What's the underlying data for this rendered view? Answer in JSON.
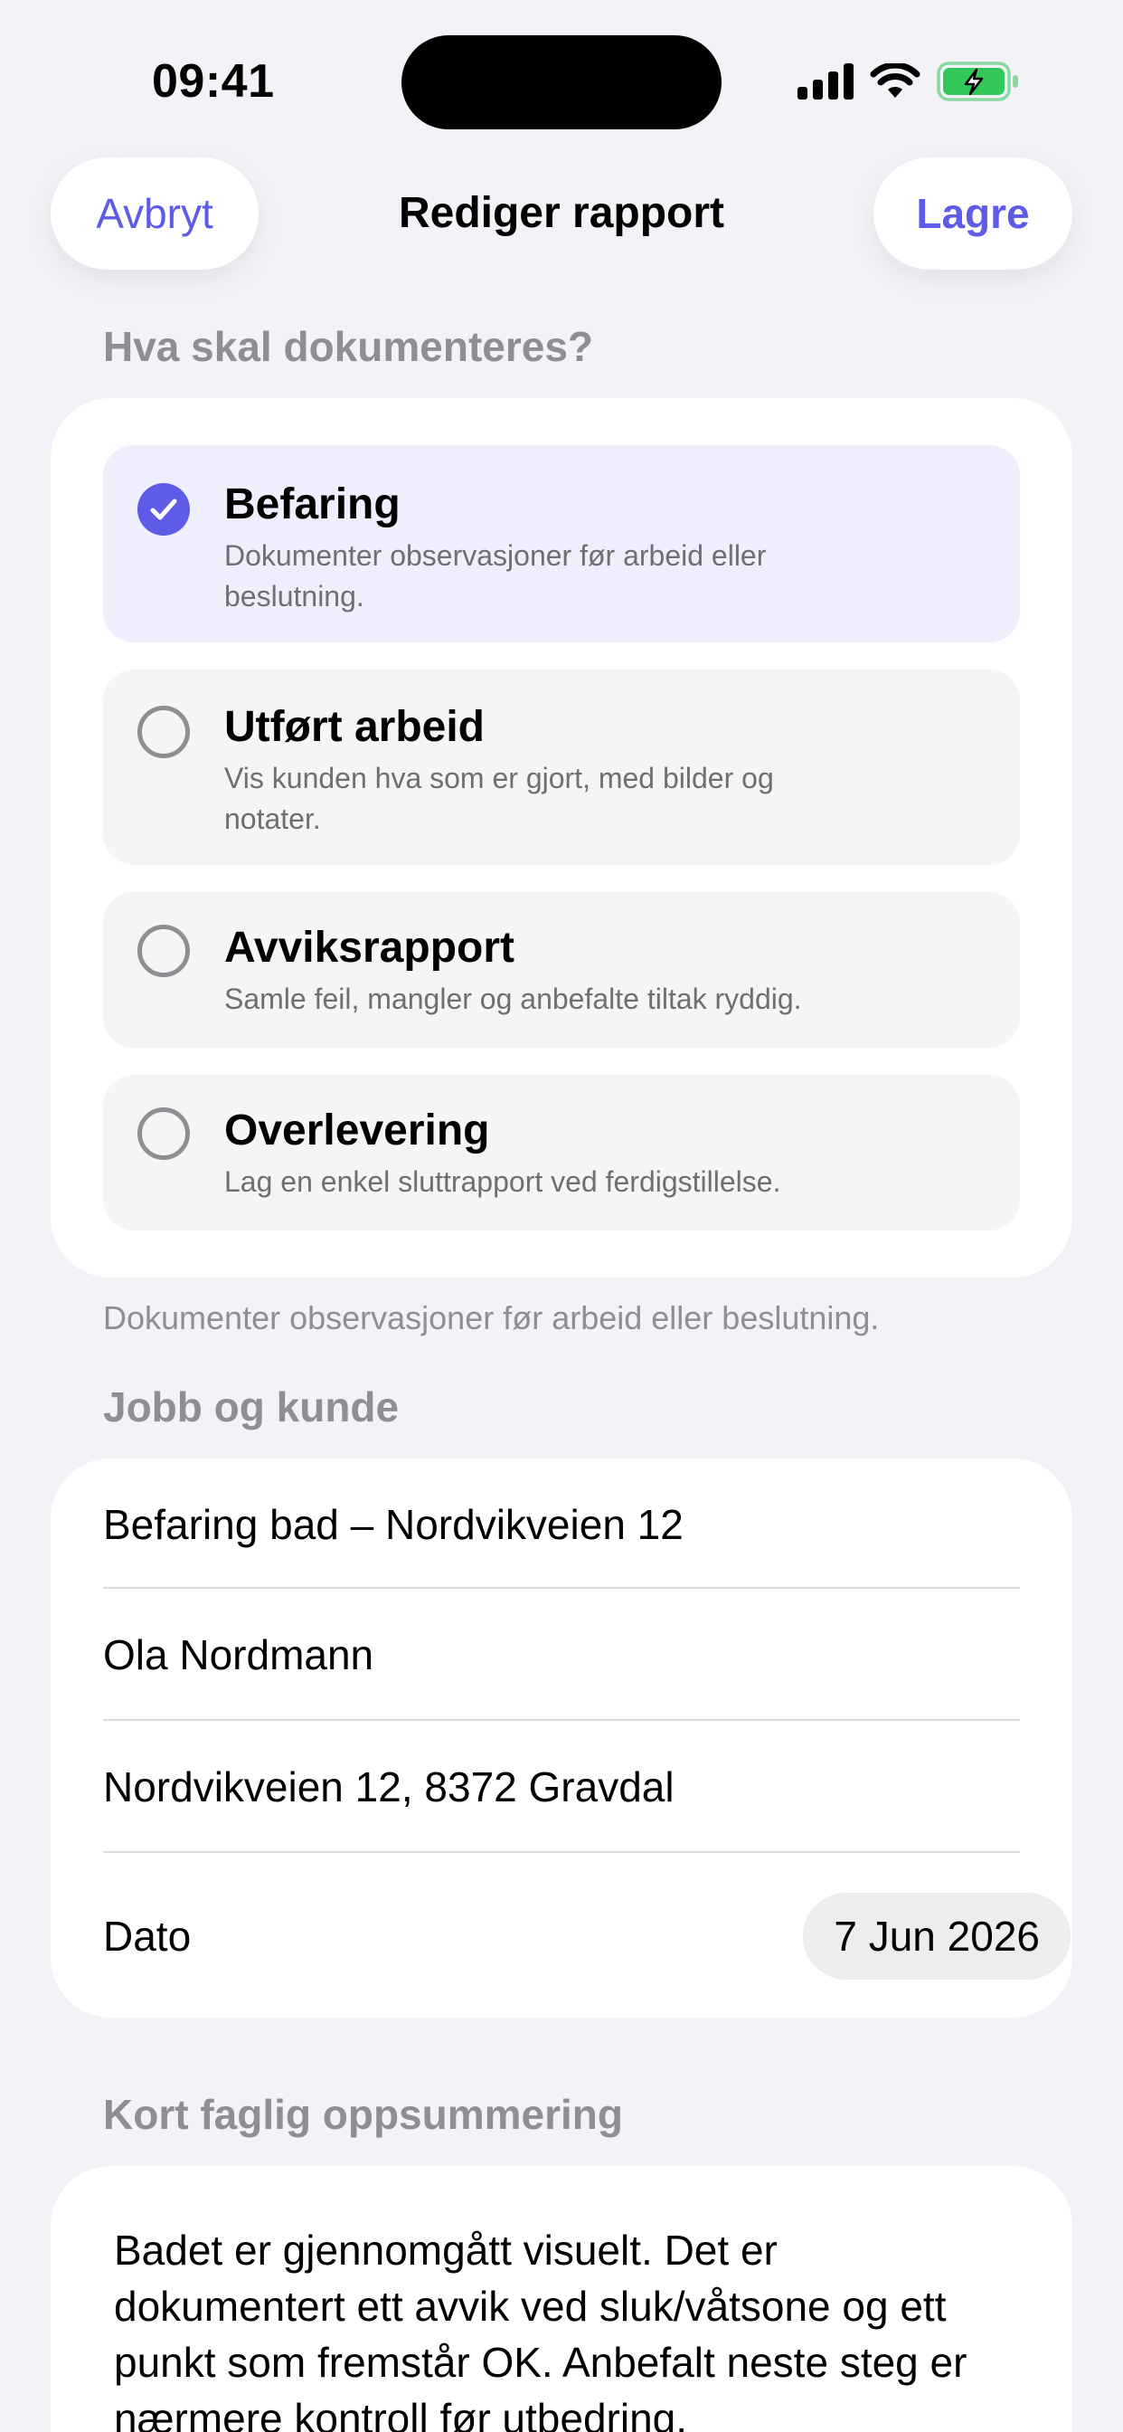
{
  "status_bar": {
    "time": "09:41",
    "icons": [
      "cellular-signal-icon",
      "wifi-icon",
      "battery-charging-icon"
    ]
  },
  "nav": {
    "cancel_label": "Avbryt",
    "title": "Rediger rapport",
    "save_label": "Lagre"
  },
  "doc_type": {
    "header": "Hva skal dokumenteres?",
    "options": [
      {
        "title": "Befaring",
        "description": "Dokumenter observasjoner før arbeid eller beslutning.",
        "selected": true
      },
      {
        "title": "Utført arbeid",
        "description": "Vis kunden hva som er gjort, med bilder og notater.",
        "selected": false
      },
      {
        "title": "Avviksrapport",
        "description": "Samle feil, mangler og anbefalte tiltak ryddig.",
        "selected": false
      },
      {
        "title": "Overlevering",
        "description": "Lag en enkel sluttrapport ved ferdigstillelse.",
        "selected": false
      }
    ],
    "footnote": "Dokumenter observasjoner før arbeid eller beslutning."
  },
  "job": {
    "header": "Jobb og kunde",
    "job_title": "Befaring bad – Nordvikveien 12",
    "customer_name": "Ola Nordmann",
    "address": "Nordvikveien 12, 8372 Gravdal",
    "date_label": "Dato",
    "date_value": "7 Jun 2026"
  },
  "summary": {
    "header": "Kort faglig oppsummering",
    "text": "Badet er gjennomgått visuelt. Det er dokumentert ett avvik ved sluk/våtsone og ett punkt som fremstår OK. Anbefalt neste steg er nærmere kontroll før utbedring."
  },
  "colors": {
    "accent": "#5E5CE6",
    "background": "#F2F2F7",
    "selected_option_bg": "#EEEEFD",
    "battery_green": "#34C759"
  }
}
